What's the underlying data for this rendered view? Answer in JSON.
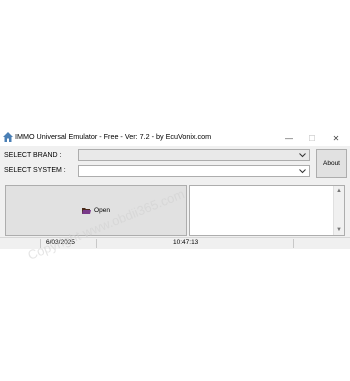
{
  "window": {
    "title": "IMMO Universal Emulator - Free - Ver: 7.2 - by EcuVonix.com",
    "controls": {
      "minimize": "—",
      "maximize": "☐",
      "close": "✕"
    }
  },
  "form": {
    "brand_label": "SELECT BRAND :",
    "system_label": "SELECT SYSTEM :",
    "brand_value": "",
    "system_value": "",
    "about_label": "About",
    "open_label": "Open",
    "log_text": ""
  },
  "status": {
    "date": "6/03/2025",
    "time": "10:47:13"
  },
  "watermark": {
    "text": "Copyright www.obdii365.com"
  },
  "icons": {
    "app": "house-icon",
    "open": "folder-icon",
    "dropdown": "chevron-down-icon"
  }
}
